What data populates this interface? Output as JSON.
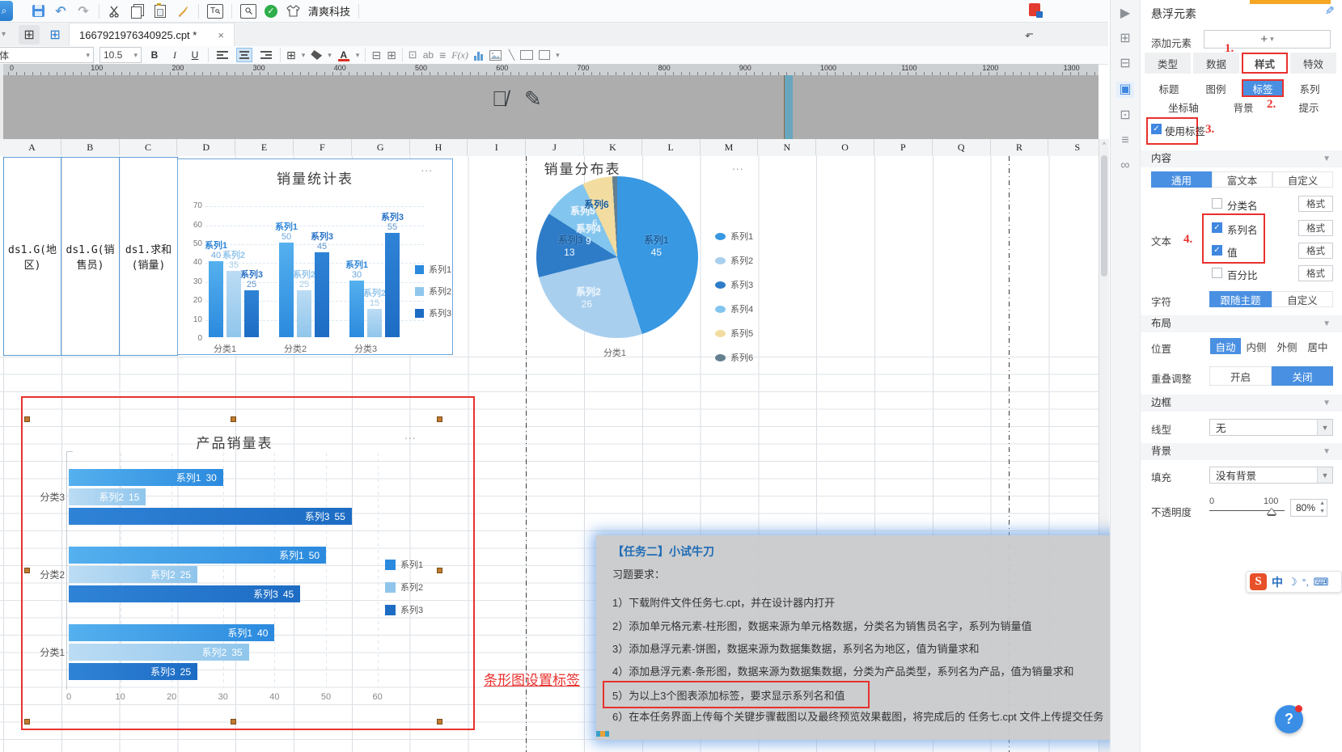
{
  "toolbar": {
    "brand_label": "清爽科技",
    "tab_label": "1667921976340925.cpt *",
    "close_tab": "×",
    "font_name": "体",
    "font_size": "10.5",
    "bold": "B",
    "italic": "I",
    "underline": "U",
    "ab_label": "ab",
    "fx_label": "F(x)",
    "dots": "..."
  },
  "ruler": {
    "marks": [
      "0",
      "100",
      "200",
      "300",
      "400",
      "500",
      "600",
      "700",
      "800",
      "900",
      "1000",
      "1100",
      "1200",
      "1300"
    ]
  },
  "grid": {
    "columns": [
      "A",
      "B",
      "C",
      "D",
      "E",
      "F",
      "G",
      "H",
      "I",
      "J",
      "K",
      "L",
      "M",
      "N",
      "O",
      "P",
      "Q",
      "R",
      "S"
    ],
    "cells": [
      "ds1.G(地区)",
      "ds1.G(销售员)",
      "ds1.求和(销量)"
    ],
    "scroll_up": "^"
  },
  "chart_data": [
    {
      "type": "bar",
      "title": "销量统计表",
      "categories": [
        "分类1",
        "分类2",
        "分类3"
      ],
      "series": [
        {
          "name": "系列1",
          "values": [
            40,
            50,
            30
          ],
          "color": "#55b0ee",
          "color2": "#2b8ade"
        },
        {
          "name": "系列2",
          "values": [
            35,
            25,
            15
          ],
          "color": "#bcdcf4",
          "color2": "#90c6ec"
        },
        {
          "name": "系列3",
          "values": [
            25,
            45,
            55
          ],
          "color": "#2f83d6",
          "color2": "#1d6cc4"
        }
      ],
      "ylim": [
        0,
        70
      ],
      "yticks": [
        0,
        10,
        20,
        30,
        40,
        50,
        60,
        70
      ],
      "legend": [
        "系列1",
        "系列2",
        "系列3"
      ],
      "labels": "series_name_and_value"
    },
    {
      "type": "pie",
      "title": "销量分布表",
      "category_label": "分类1",
      "series": [
        {
          "name": "系列1",
          "value": 45,
          "color": "#3898e2"
        },
        {
          "name": "系列2",
          "value": 26,
          "color": "#a9cfee"
        },
        {
          "name": "系列3",
          "value": 13,
          "color": "#2e7cc8"
        },
        {
          "name": "系列4",
          "value": 9,
          "color": "#82c5ee"
        },
        {
          "name": "系列5",
          "value": 6,
          "color": "#f2dca0"
        },
        {
          "name": "系列6",
          "value": 1,
          "color": "#64808f"
        }
      ],
      "legend": [
        "系列1",
        "系列2",
        "系列3",
        "系列4",
        "系列5",
        "系列6"
      ],
      "legend_position": "right"
    },
    {
      "type": "bar_horizontal",
      "title": "产品销量表",
      "categories": [
        "分类3",
        "分类2",
        "分类1"
      ],
      "series": [
        {
          "name": "系列1",
          "values": [
            30,
            50,
            40
          ],
          "color": "#55b0ee",
          "color2": "#2b8ade"
        },
        {
          "name": "系列2",
          "values": [
            15,
            25,
            35
          ],
          "color": "#bcdcf4",
          "color2": "#90c6ec"
        },
        {
          "name": "系列3",
          "values": [
            55,
            45,
            25
          ],
          "color": "#2f83d6",
          "color2": "#1d6cc4"
        }
      ],
      "xticks": [
        0,
        10,
        20,
        30,
        40,
        50,
        60
      ],
      "legend": [
        "系列1",
        "系列2",
        "系列3"
      ],
      "labels": "series_name_and_value"
    }
  ],
  "annotations": {
    "bar_label_note": "条形图设置标签",
    "steps": [
      "1.",
      "2.",
      "3.",
      "4."
    ]
  },
  "task_panel": {
    "title": "【任务二】小试牛刀",
    "subtitle": "习题要求：",
    "items": [
      "1）下载附件文件任务七.cpt，并在设计器内打开",
      "2）添加单元格元素-柱形图，数据来源为单元格数据，分类名为销售员名字，系列为销量值",
      "3）添加悬浮元素-饼图，数据来源为数据集数据，系列名为地区，值为销量求和",
      "4）添加悬浮元素-条形图，数据来源为数据集数据，分类为产品类型，系列名为产品，值为销量求和",
      "5）为以上3个图表添加标签，要求显示系列名和值",
      "6）在本任务界面上传每个关键步骤截图以及最终预览效果截图，将完成后的 任务七.cpt 文件上传提交任务"
    ]
  },
  "right_panel": {
    "title": "悬浮元素",
    "add_element_label": "添加元素",
    "add_button": "+",
    "main_tabs": [
      "类型",
      "数据",
      "样式",
      "特效"
    ],
    "style_subtabs": [
      "标题",
      "图例",
      "标签",
      "系列"
    ],
    "style_subtabs2": [
      "坐标轴",
      "背景",
      "提示"
    ],
    "use_label_checkbox": "使用标签",
    "content_section": "内容",
    "content_tabs": [
      "通用",
      "富文本",
      "自定义"
    ],
    "text_label": "文本",
    "text_options": [
      {
        "label": "分类名",
        "checked": false
      },
      {
        "label": "系列名",
        "checked": true
      },
      {
        "label": "值",
        "checked": true
      },
      {
        "label": "百分比",
        "checked": false
      }
    ],
    "format_button": "格式",
    "char_label": "字符",
    "char_options": [
      "跟随主题",
      "自定义"
    ],
    "layout_section": "布局",
    "position_label": "位置",
    "position_options": [
      "自动",
      "内侧",
      "外侧",
      "居中"
    ],
    "overlap_label": "重叠调整",
    "overlap_options": [
      "开启",
      "关闭"
    ],
    "border_section": "边框",
    "line_type_label": "线型",
    "line_type_value": "无",
    "background_section": "背景",
    "fill_label": "填充",
    "fill_value": "没有背景",
    "opacity_label": "不透明度",
    "opacity_min": "0",
    "opacity_max": "100",
    "opacity_value": "80%"
  },
  "ime": {
    "logo": "S",
    "mode": "中",
    "moon": "☽",
    "punct": "°,",
    "keyboard": "⌨"
  },
  "help": {
    "label": "?"
  }
}
